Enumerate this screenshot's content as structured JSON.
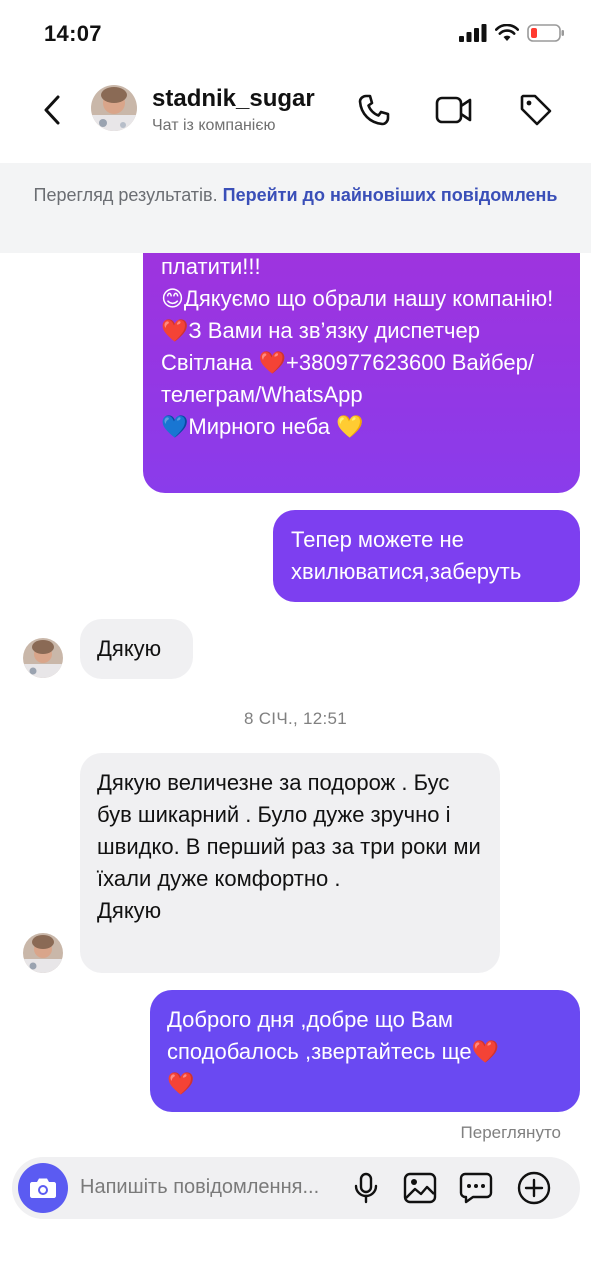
{
  "status_bar": {
    "time": "14:07"
  },
  "header": {
    "title": "stadnik_sugar",
    "subtitle": "Чат із компанією"
  },
  "banner": {
    "text": "Перегляд результатів. ",
    "link": "Перейти до найновіших повідомлень"
  },
  "messages": [
    {
      "direction": "out",
      "text": "платити!!!\n😊Дякуємо що обрали нашу компанію!\n❤️З Вами на зв’язку диспетчер Світлана ❤️+380977623600 Вайбер/телеграм/WhatsApp\n💙Мирного неба 💛"
    },
    {
      "direction": "out",
      "text": "Тепер можете не хвилюватися,заберуть"
    },
    {
      "direction": "in",
      "text": "Дякую"
    },
    {
      "direction": "in",
      "text": "Дякую величезне за подорож . Бус був шикарний . Було дуже зручно і швидко.  В перший раз за три роки ми їхали дуже комфортно .\nДякую"
    },
    {
      "direction": "out",
      "text": "Доброго дня ,добре що Вам сподобалось ,звертайтесь ще❤️\n❤️"
    }
  ],
  "timestamp": "8 СІЧ., 12:51",
  "seen_label": "Переглянуто",
  "composer": {
    "placeholder": "Напишіть повідомлення..."
  },
  "colors": {
    "outgoing_top": "#a232dc",
    "outgoing_mid": "#7d3ff0",
    "outgoing_bottom": "#6a49f2",
    "incoming": "#f0f0f2",
    "camera_button": "#5b5bf2",
    "link": "#3a4fb8"
  },
  "icons": {
    "back": "chevron-left-icon",
    "call": "phone-icon",
    "video": "video-camera-icon",
    "tag": "tag-icon",
    "camera": "camera-icon",
    "mic": "microphone-icon",
    "gallery": "image-icon",
    "sticker": "chat-bubble-icon",
    "add": "plus-circle-icon"
  }
}
